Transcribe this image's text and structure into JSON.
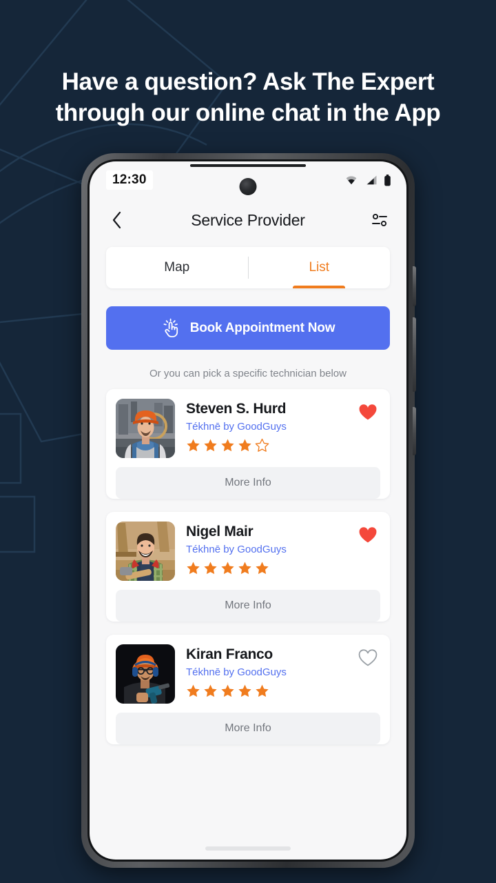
{
  "promo": {
    "headline_line1": "Have a question? Ask The Expert",
    "headline_line2": "through our online chat in the App",
    "background_color": "#152639",
    "headline_color": "#ffffff"
  },
  "status_bar": {
    "time": "12:30",
    "icons": [
      "wifi-icon",
      "cellular-signal-icon",
      "battery-icon"
    ]
  },
  "header": {
    "back_icon": "chevron-left-icon",
    "title": "Service Provider",
    "filter_icon": "filter-settings-icon"
  },
  "tabs": {
    "items": [
      {
        "label": "Map",
        "active": false
      },
      {
        "label": "List",
        "active": true
      }
    ],
    "active_color": "#f07c1e"
  },
  "cta": {
    "icon": "tap-hand-icon",
    "label": "Book Appointment Now",
    "color": "#5370ef",
    "hint": "Or you can pick a specific technician below"
  },
  "providers": [
    {
      "name": "Steven S. Hurd",
      "company": "Tékhnē by GoodGuys",
      "rating": 4,
      "max_rating": 5,
      "favorite": true,
      "favorite_icon": "heart-filled-icon",
      "action_label": "More Info",
      "avatar_alt": "worker-orange-helmet-blue-overalls"
    },
    {
      "name": "Nigel Mair",
      "company": "Tékhnē by GoodGuys",
      "rating": 5,
      "max_rating": 5,
      "favorite": true,
      "favorite_icon": "heart-filled-icon",
      "action_label": "More Info",
      "avatar_alt": "carpenter-plaid-shirt-workshop"
    },
    {
      "name": "Kiran Franco",
      "company": "Tékhnē by GoodGuys",
      "rating": 5,
      "max_rating": 5,
      "favorite": false,
      "favorite_icon": "heart-outline-icon",
      "action_label": "More Info",
      "avatar_alt": "worker-helmet-ear-protection-drill"
    }
  ],
  "colors": {
    "star_filled": "#f07c1e",
    "star_empty_stroke": "#f07c1e",
    "heart_filled": "#f4483b",
    "heart_outline": "#9aa0a6",
    "company_link": "#5370ef",
    "screen_bg": "#f7f7f8",
    "card_bg": "#ffffff"
  },
  "system": {
    "home_indicator": "home-indicator-bar"
  }
}
